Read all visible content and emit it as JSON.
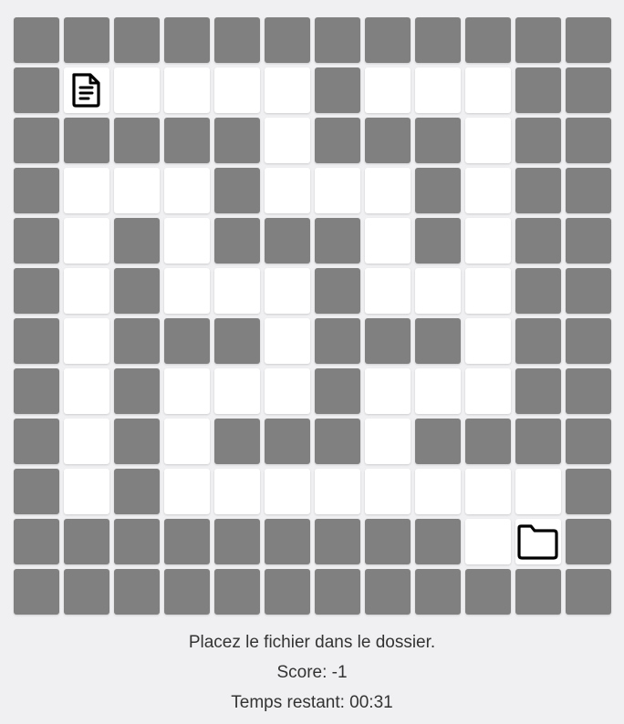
{
  "game": {
    "grid": {
      "rows": 12,
      "cols": 12,
      "wall_color": "#808080",
      "path_color": "#ffffff",
      "layout": [
        "############",
        "#F....#...##",
        "#####.###.##",
        "#...#...#.##",
        "#.#.###.#.##",
        "#.#...#...##",
        "#.###.###.##",
        "#.#...#...##",
        "#.#.###.####",
        "#.#........#",
        "#########.D#",
        "############"
      ],
      "legend": {
        "#": "wall",
        ".": "path",
        "F": "file",
        "D": "folder"
      },
      "file_icon": "file-document-icon",
      "folder_icon": "folder-icon"
    },
    "instruction": "Placez le fichier dans le dossier.",
    "score_text": "Score: -1",
    "timer_text": "Temps restant: 00:31"
  }
}
